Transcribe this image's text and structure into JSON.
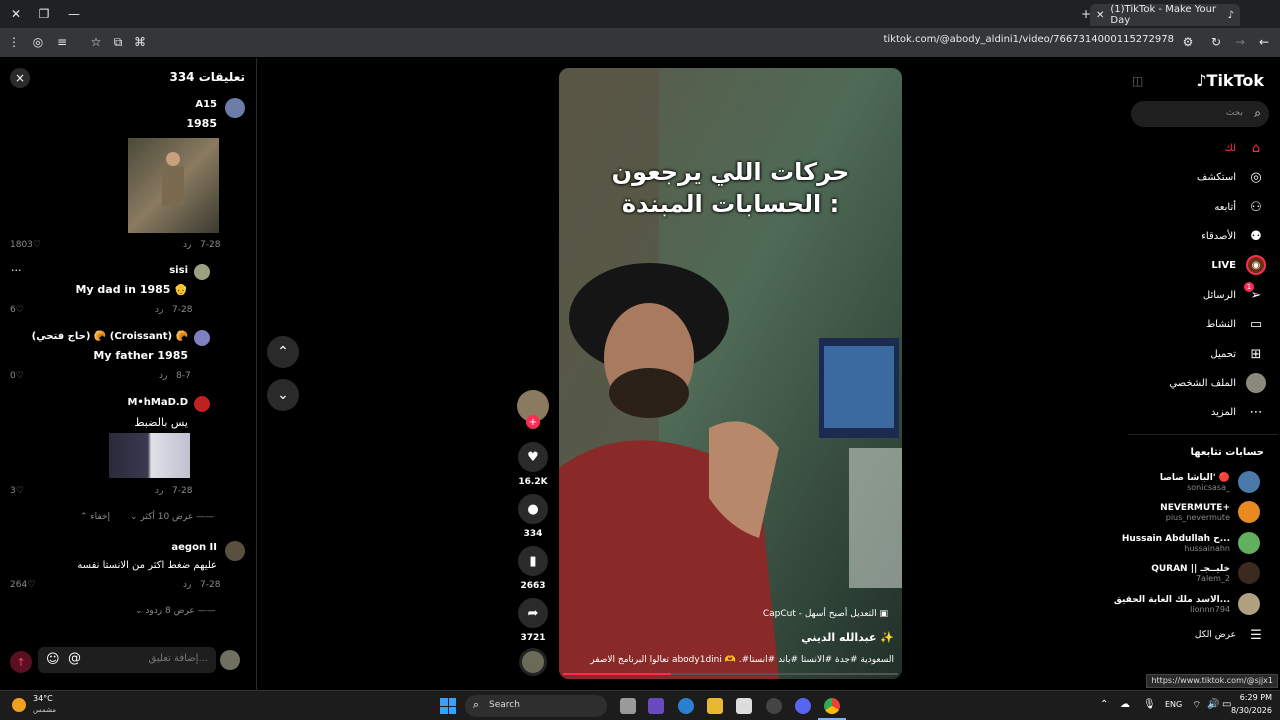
{
  "browser": {
    "tab_title": "(1)TikTok - Make Your Day",
    "url": "tiktok.com/@abody_aldini1/video/7667314000115272978",
    "status_url": "https://www.tiktok.com/@sjjx1"
  },
  "comments_panel": {
    "title": "تعليقات 334",
    "close_label": "×",
    "comments": [
      {
        "author": "A15",
        "text": "1985",
        "date": "7-28",
        "reply": "رد",
        "likes": "1803"
      },
      {
        "author": "sisi",
        "text": "My dad in 1985 👴",
        "date": "7-28",
        "reply": "رد",
        "likes": "6",
        "more": "..."
      },
      {
        "author": "(حاج فتحي) 🥐 (Croissant) 🥐",
        "text": "My father 1985",
        "date": "8-7",
        "reply": "رد",
        "likes": "0"
      },
      {
        "author": "M•hMaD.D",
        "text": "يس بالضبط",
        "date": "7-28",
        "reply": "رد",
        "likes": "3"
      },
      {
        "author": "aegon II",
        "text": "عليهم ضغط اكثر من الانستا نفسه",
        "date": "7-28",
        "reply": "رد",
        "likes": "264"
      }
    ],
    "show_more_1": "عرض 10 أكثر",
    "hide": "إخفاء",
    "show_more_2": "عرض 8 ردود",
    "input_placeholder": "إضافة تعليق..."
  },
  "video": {
    "caption": "حركات اللي يرجعون الحسابات المبندة :",
    "capcut": "CapCut - التعديل أصبح أسهل",
    "author": "عبدالله الديني ✨",
    "description": "تعالوا البرنامج الاصفر abody1dini 🫶 .#السعودية #جدة #الانستا #باند #انستا"
  },
  "actions": {
    "likes": "16.2K",
    "comments": "334",
    "saves": "2663",
    "shares": "3721"
  },
  "sidebar": {
    "logo": "TikTok",
    "search_placeholder": "بحث",
    "nav": [
      {
        "label": "لك",
        "icon": "home-icon"
      },
      {
        "label": "استكشف",
        "icon": "compass-icon"
      },
      {
        "label": "أتابعه",
        "icon": "user-follow-icon"
      },
      {
        "label": "الأصدقاء",
        "icon": "friends-icon"
      },
      {
        "label": "LIVE",
        "icon": "live-icon"
      },
      {
        "label": "الرسائل",
        "icon": "messages-icon",
        "badge": "1"
      },
      {
        "label": "النشاط",
        "icon": "activity-icon"
      },
      {
        "label": "تحميل",
        "icon": "upload-icon"
      },
      {
        "label": "الملف الشخصي",
        "icon": "profile-icon"
      },
      {
        "label": "المزيد",
        "icon": "more-icon"
      }
    ],
    "following_title": "حسابات تتابعها",
    "following": [
      {
        "name": "الباشا صاصا' 🔴",
        "handle": "sonicsasa_"
      },
      {
        "name": "NEVERMUTE+",
        "handle": "pius_nevermute"
      },
      {
        "name": "Hussain Abdullah ح...",
        "handle": "hussainahn"
      },
      {
        "name": "QURAN || خليــجـ",
        "handle": "7alem_2"
      },
      {
        "name": "الاسد ملك الغابة الحقيق...",
        "handle": "lionnn794"
      }
    ],
    "see_all": "عرض الكل"
  },
  "taskbar": {
    "temp": "34°C",
    "weather": "مشمس",
    "search": "Search",
    "lang": "ENG",
    "time": "6:29 PM",
    "date": "8/30/2026"
  }
}
